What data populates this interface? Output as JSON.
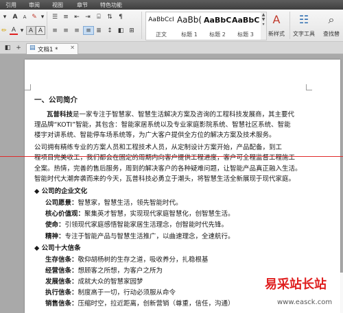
{
  "menu": [
    "引用",
    "审阅",
    "视图",
    "章节",
    "特色功能"
  ],
  "ribbon": {
    "styles": [
      {
        "sample": "AaBbCcI",
        "name": "正文"
      },
      {
        "sample": "AaBb(",
        "name": "标题 1"
      },
      {
        "sample": "AaBbC",
        "name": "标题 2"
      },
      {
        "sample": "AaBbC",
        "name": "标题 3"
      }
    ],
    "new_style": "新样式",
    "text_tools": "文字工具",
    "find_replace": "查找替"
  },
  "tabs": {
    "doc_name": "文档1 *"
  },
  "document": {
    "heading1": "一、公司简介",
    "intro": [
      {
        "bold": "瓦普科技",
        "text": "是一家专注于智慧家、智慧生活解决方案及咨询的工程科技发展商，其主要代"
      },
      {
        "text": "理品牌“KOTI”智能，其包含：智能家居系统以及专业家庭影院系统、智慧社区系统、智能"
      },
      {
        "text": "楼宇对讲系统、智能停车场系统等，为广大客户提供全方位的解决方案及技术服务。"
      },
      {
        "text": "    公司拥有精练专业的方案人员和工程技术人员，从定制设计方案开始，产品配备，到工"
      },
      {
        "text": "程项目完美收工，我们都会在固定的周期内向客户提供工程进度，客户可全程监督工程施工"
      },
      {
        "text": "全案。热情，完善的售后服务，周到的解决客户的各种疑难问题，让智能产品真正融入生活。"
      },
      {
        "text": "智能时代大潮奔袭而来的今天，瓦普科技必勇立于潮头，将智慧生活全新展现于现代家庭。"
      }
    ],
    "culture_heading": "◆ 公司的企业文化",
    "culture": [
      {
        "label": "公司愿景：",
        "text": "智慧家，智慧生活，领先智能时代。"
      },
      {
        "label": "核心价值观：",
        "text": "聚集英才智慧，实现现代家庭智慧化，创智慧生活。"
      },
      {
        "label": "使命：",
        "text": "引领现代家庭感悟智能家居生活理念，创智能时代先锋。"
      },
      {
        "label": "精神：",
        "text": "专注于智能产品与智慧生活推广，以曲速理念，全速航行。"
      }
    ],
    "beliefs_heading": "◆ 公司十大信条",
    "beliefs": [
      {
        "label": "生存信条：",
        "text": "敬仰胡杨树的生存之道，吸收养分，扎稳根基"
      },
      {
        "label": "经营信条：",
        "text": "想顾客之所想，为客户之所为"
      },
      {
        "label": "发展信条：",
        "text": "成就大众的智慧家园梦"
      },
      {
        "label": "执行信条：",
        "text": "制度高于一切，行动必须服从命令"
      },
      {
        "label": "销售信条：",
        "text": "压缩时空，拉近距离，创新营销（尊重，信任，沟通）"
      }
    ]
  },
  "watermark": {
    "title": "易采站长站",
    "url": "www.easck.com"
  }
}
